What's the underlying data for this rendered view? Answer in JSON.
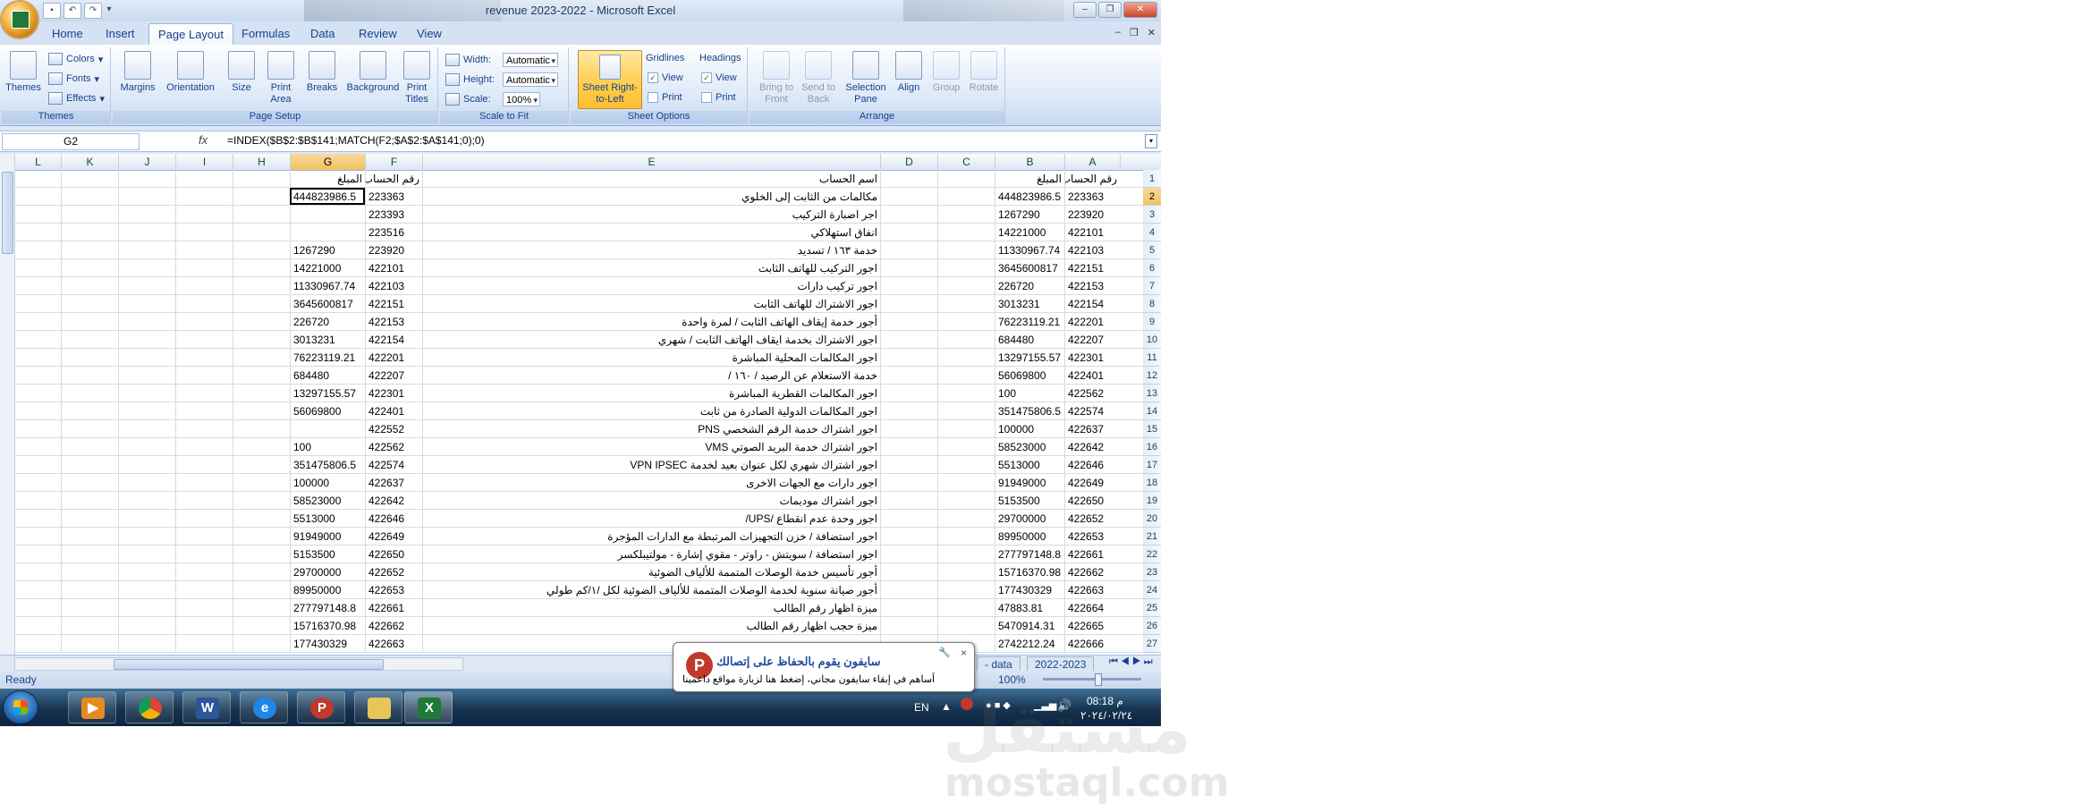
{
  "window": {
    "title": "revenue 2023-2022 - Microsoft Excel"
  },
  "tabs": [
    {
      "label": "Home"
    },
    {
      "label": "Insert"
    },
    {
      "label": "Page Layout",
      "active": true
    },
    {
      "label": "Formulas"
    },
    {
      "label": "Data"
    },
    {
      "label": "Review"
    },
    {
      "label": "View"
    }
  ],
  "ribbon": {
    "themes": {
      "themes_label": "Themes",
      "colors": "Colors",
      "fonts": "Fonts",
      "effects": "Effects",
      "group": "Themes"
    },
    "page_setup": {
      "margins": "Margins",
      "orientation": "Orientation",
      "size": "Size",
      "print_area": "Print Area",
      "breaks": "Breaks",
      "background": "Background",
      "print_titles": "Print Titles",
      "group": "Page Setup"
    },
    "scale": {
      "width_label": "Width:",
      "width_value": "Automatic",
      "height_label": "Height:",
      "height_value": "Automatic",
      "scale_label": "Scale:",
      "scale_value": "100%",
      "group": "Scale to Fit"
    },
    "sheet_options": {
      "rtl": "Sheet Right-to-Left",
      "gridlines": "Gridlines",
      "headings": "Headings",
      "view": "View",
      "print": "Print",
      "group": "Sheet Options"
    },
    "arrange": {
      "bring_to_front": "Bring to Front",
      "send_to_back": "Send to Back",
      "selection_pane": "Selection Pane",
      "align": "Align",
      "group_btn": "Group",
      "rotate": "Rotate",
      "group": "Arrange"
    }
  },
  "formula_bar": {
    "name_box": "G2",
    "fx": "fx",
    "formula": "=INDEX($B$2:$B$141;MATCH(F2;$A$2:$A$141;0);0)"
  },
  "columns": [
    "L",
    "K",
    "J",
    "I",
    "H",
    "G",
    "F",
    "E",
    "D",
    "C",
    "B",
    "A"
  ],
  "rows": [
    {
      "r": "1",
      "A": "رقم الحساب",
      "B": "المبلغ",
      "E": "اسم الحساب",
      "F": "رقم الحساب",
      "G": "المبلغ"
    },
    {
      "r": "2",
      "A": "223363",
      "B": "444823986.5",
      "E": "مكالمات من الثابت إلى الخلوي",
      "F": "223363",
      "G": "444823986.5"
    },
    {
      "r": "3",
      "A": "223920",
      "B": "1267290",
      "E": "اجر اضبارة التركيب",
      "F": "223393",
      "G": ""
    },
    {
      "r": "4",
      "A": "422101",
      "B": "14221000",
      "E": "انفاق استهلاكي",
      "F": "223516",
      "G": ""
    },
    {
      "r": "5",
      "A": "422103",
      "B": "11330967.74",
      "E": "خدمة ١٦٣ / تسديد",
      "F": "223920",
      "G": "1267290"
    },
    {
      "r": "6",
      "A": "422151",
      "B": "3645600817",
      "E": "اجور التركيب للهاتف الثابت",
      "F": "422101",
      "G": "14221000"
    },
    {
      "r": "7",
      "A": "422153",
      "B": "226720",
      "E": "اجور تركيب دارات",
      "F": "422103",
      "G": "11330967.74"
    },
    {
      "r": "8",
      "A": "422154",
      "B": "3013231",
      "E": "اجور الاشتراك للهاتف الثابت",
      "F": "422151",
      "G": "3645600817"
    },
    {
      "r": "9",
      "A": "422201",
      "B": "76223119.21",
      "E": "أجور خدمة إيقاف الهاتف الثابت / لمرة واحدة",
      "F": "422153",
      "G": "226720"
    },
    {
      "r": "10",
      "A": "422207",
      "B": "684480",
      "E": "اجور الاشتراك بخدمة ايقاف الهاتف الثابت / شهري",
      "F": "422154",
      "G": "3013231"
    },
    {
      "r": "11",
      "A": "422301",
      "B": "13297155.57",
      "E": "اجور المكالمات المحلية المباشرة",
      "F": "422201",
      "G": "76223119.21"
    },
    {
      "r": "12",
      "A": "422401",
      "B": "56069800",
      "E": "خدمة الاستعلام عن الرصيد / ١٦٠ /",
      "F": "422207",
      "G": "684480"
    },
    {
      "r": "13",
      "A": "422562",
      "B": "100",
      "E": "اجور المكالمات القطرية المباشرة",
      "F": "422301",
      "G": "13297155.57"
    },
    {
      "r": "14",
      "A": "422574",
      "B": "351475806.5",
      "E": "اجور المكالمات الدولية الصادرة من ثابت",
      "F": "422401",
      "G": "56069800"
    },
    {
      "r": "15",
      "A": "422637",
      "B": "100000",
      "E": "اجور اشتراك خدمة الرقم الشخصي PNS",
      "F": "422552",
      "G": ""
    },
    {
      "r": "16",
      "A": "422642",
      "B": "58523000",
      "E": "اجور اشتراك خدمة البريد الصوتي VMS",
      "F": "422562",
      "G": "100"
    },
    {
      "r": "17",
      "A": "422646",
      "B": "5513000",
      "E": "اجور اشتراك شهري لكل عنوان بعيد لخدمة VPN IPSEC",
      "F": "422574",
      "G": "351475806.5"
    },
    {
      "r": "18",
      "A": "422649",
      "B": "91949000",
      "E": "اجور دارات مع الجهات الاخرى",
      "F": "422637",
      "G": "100000"
    },
    {
      "r": "19",
      "A": "422650",
      "B": "5153500",
      "E": "اجور اشتراك موديمات",
      "F": "422642",
      "G": "58523000"
    },
    {
      "r": "20",
      "A": "422652",
      "B": "29700000",
      "E": "اجور وحدة عدم انقطاع /UPS/",
      "F": "422646",
      "G": "5513000"
    },
    {
      "r": "21",
      "A": "422653",
      "B": "89950000",
      "E": "اجور استضافة / خزن التجهيزات المرتبطة مع الدارات المؤجرة",
      "F": "422649",
      "G": "91949000"
    },
    {
      "r": "22",
      "A": "422661",
      "B": "277797148.8",
      "E": "اجور استضافة / سويتش - راوتر - مقوي إشارة - مولتيبلكسر",
      "F": "422650",
      "G": "5153500"
    },
    {
      "r": "23",
      "A": "422662",
      "B": "15716370.98",
      "E": "أجور تأسيس خدمة الوصلات المتممة للألياف الضوئية",
      "F": "422652",
      "G": "29700000"
    },
    {
      "r": "24",
      "A": "422663",
      "B": "177430329",
      "E": "أجور صيانة سنوية لخدمة الوصلات المتممة للألياف الضوئية لكل /١/كم طولي",
      "F": "422653",
      "G": "89950000"
    },
    {
      "r": "25",
      "A": "422664",
      "B": "47883.81",
      "E": "ميزة اظهار رقم الطالب",
      "F": "422661",
      "G": "277797148.8"
    },
    {
      "r": "26",
      "A": "422665",
      "B": "5470914.31",
      "E": "ميزة حجب اظهار رقم الطالب",
      "F": "422662",
      "G": "15716370.98"
    },
    {
      "r": "27",
      "A": "422666",
      "B": "2742212.24",
      "E": "",
      "F": "422663",
      "G": "177430329"
    }
  ],
  "sheet_tabs": [
    "- data",
    "2022-2023"
  ],
  "status": {
    "ready": "Ready",
    "zoom": "100%"
  },
  "notification": {
    "title": "سايفون يقوم بالحفاظ على إتصالك",
    "body": "أساهم في إبقاء سايفون مجاني، إضغط هنا لزيارة مواقع داعمينا",
    "close": "×"
  },
  "tray": {
    "lang": "EN",
    "time": "08:18 م",
    "date": "٢٠٢٤/٠٢/٢٤"
  },
  "watermark": {
    "ar": "مستقل",
    "en": "mostaql.com"
  }
}
